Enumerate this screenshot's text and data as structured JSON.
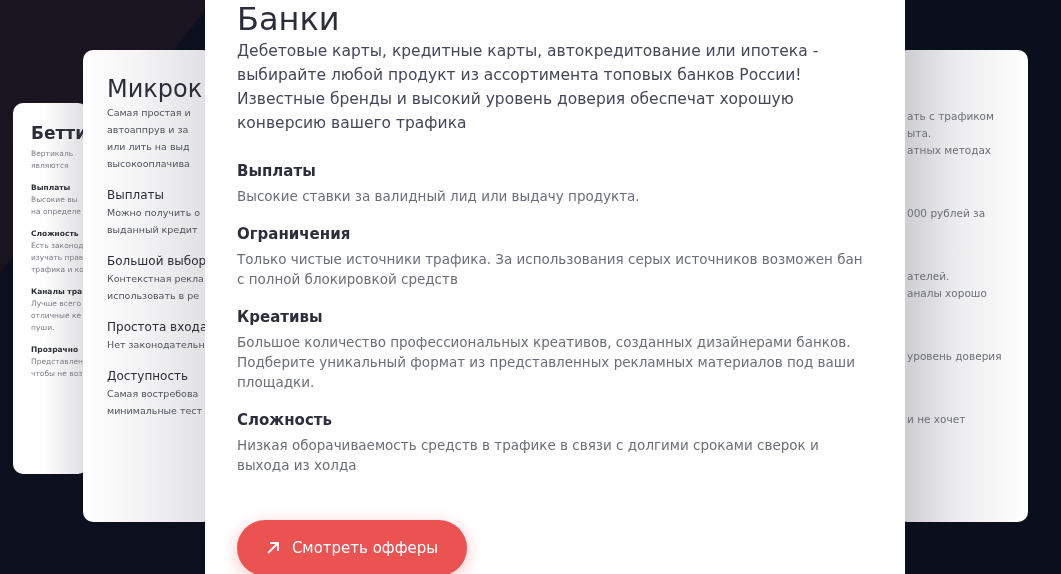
{
  "back_cards": [
    {
      "kind": "far-left",
      "title": "Бетти",
      "intro": [
        "Вертикаль",
        "являются"
      ],
      "sections": [
        {
          "heading": "Выплаты",
          "lines": [
            "Высокие вы",
            "на определе"
          ]
        },
        {
          "heading": "Сложность",
          "lines": [
            "Есть законод",
            "изучать прав",
            "трафика и ко"
          ]
        },
        {
          "heading": "Каналы тра",
          "lines": [
            "Лучше всего",
            "отличные ке",
            "пуши."
          ]
        },
        {
          "heading": "Прозрачно",
          "lines": [
            "Представлен",
            "чтобы не воз"
          ]
        }
      ]
    },
    {
      "kind": "left",
      "title": "Микрок",
      "intro": [
        "Самая простая и",
        "автоаппрув и за",
        "или лить на выд",
        "высокооплачива"
      ],
      "sections": [
        {
          "heading": "Выплаты",
          "lines": [
            "Можно получить о",
            "выданный кредит"
          ]
        },
        {
          "heading": "Большой выбор",
          "lines": [
            "Контекстная рекла",
            "использовать в ре"
          ]
        },
        {
          "heading": "Простота входа",
          "lines": [
            "Нет законодательн"
          ]
        },
        {
          "heading": "Доступность",
          "lines": [
            "Самая востребова",
            "минимальные тест"
          ]
        }
      ]
    },
    {
      "kind": "right",
      "intro": [
        "ать с трафиком",
        "ыта.",
        "атных методах"
      ],
      "sections": [
        {
          "lines": [
            "000 рублей за"
          ]
        },
        {
          "lines": [
            "ателей.",
            "аналы хорошо"
          ]
        },
        {
          "lines": [
            "уровень доверия"
          ]
        },
        {
          "lines": [
            "и не хочет"
          ]
        }
      ]
    }
  ],
  "active_card": {
    "title": "Банки",
    "description": "Дебетовые карты, кредитные карты, автокредитование или ипотека - выбирайте любой продукт из ассортимента топовых банков России! Известные бренды и высокий уровень доверия обеспечат хорошую конверсию вашего трафика",
    "sections": [
      {
        "heading": "Выплаты",
        "text": "Высокие ставки за валидный лид или выдачу продукта."
      },
      {
        "heading": "Ограничения",
        "text": "Только чистые источники трафика. За использования серых источников возможен бан с полной блокировкой средств"
      },
      {
        "heading": "Креативы",
        "text": "Большое количество профессиональных креативов, созданных дизайнерами банков. Подберите уникальный формат из представленных рекламных материалов под ваши площадки."
      },
      {
        "heading": "Сложность",
        "text": "Низкая оборачиваемость средств в трафике в связи с долгими сроками сверок и выхода из холда"
      }
    ],
    "button": {
      "label": "Смотреть офферы"
    }
  }
}
